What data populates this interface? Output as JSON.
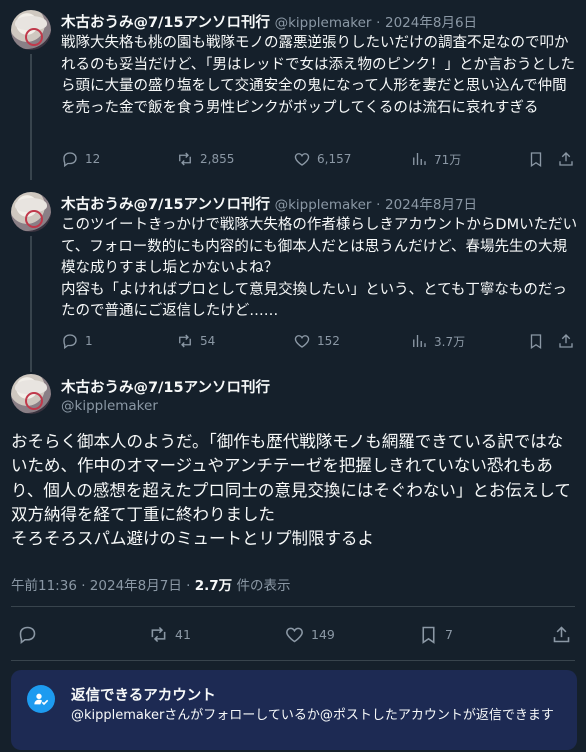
{
  "tweets": [
    {
      "name": "木古おうみ@7/15アンソロ刊行",
      "handle": "@kipplemaker",
      "date": "2024年8月6日",
      "text": "戦隊大失格も桃の園も戦隊モノの露悪逆張りしたいだけの調査不足なので叩かれるのも妥当だけど、「男はレッドで女は添え物のピンク！」とか言おうとしたら頭に大量の盛り塩をして交通安全の鬼になって人形を妻だと思い込んで仲間を売った金で飯を食う男性ピンクがポップしてくるのは流石に哀れすぎる",
      "stats": {
        "replies": "12",
        "reposts": "2,855",
        "likes": "6,157",
        "views": "71万"
      }
    },
    {
      "name": "木古おうみ@7/15アンソロ刊行",
      "handle": "@kipplemaker",
      "date": "2024年8月7日",
      "text_lines": [
        "このツイートきっかけで戦隊大失格の作者様らしきアカウントからDMいただいて、フォロー数的にも内容的にも御本人だとは思うんだけど、春場先生の大規模な成りすまし垢とかないよね？",
        "内容も「よければプロとして意見交換したい」という、とても丁寧なものだったので普通にご返信したけど……"
      ],
      "stats": {
        "replies": "1",
        "reposts": "54",
        "likes": "152",
        "views": "3.7万"
      }
    }
  ],
  "main": {
    "name": "木古おうみ@7/15アンソロ刊行",
    "handle": "@kipplemaker",
    "text_lines": [
      "おそらく御本人のようだ。「御作も歴代戦隊モノも網羅できている訳ではないため、作中のオマージュやアンチテーゼを把握しきれていない恐れもあり、個人の感想を超えたプロ同士の意見交換にはそぐわない」とお伝えして双方納得を経て丁重に終わりました",
      "そろそろスパム避けのミュートとリプ制限するよ"
    ],
    "time": "午前11:36",
    "date": "2024年8月7日",
    "views_count": "2.7万",
    "views_label": "件の表示",
    "stats": {
      "reposts": "41",
      "likes": "149",
      "bookmarks": "7"
    }
  },
  "reply_notice": {
    "title": "返信できるアカウント",
    "description": "@kipplemakerさんがフォローしているか@ポストしたアカウントが返信できます"
  },
  "colors": {
    "background": "#15202b",
    "accent": "#1d9bf0",
    "muted": "#8b98a5",
    "notice_bg": "#1d2a53"
  }
}
